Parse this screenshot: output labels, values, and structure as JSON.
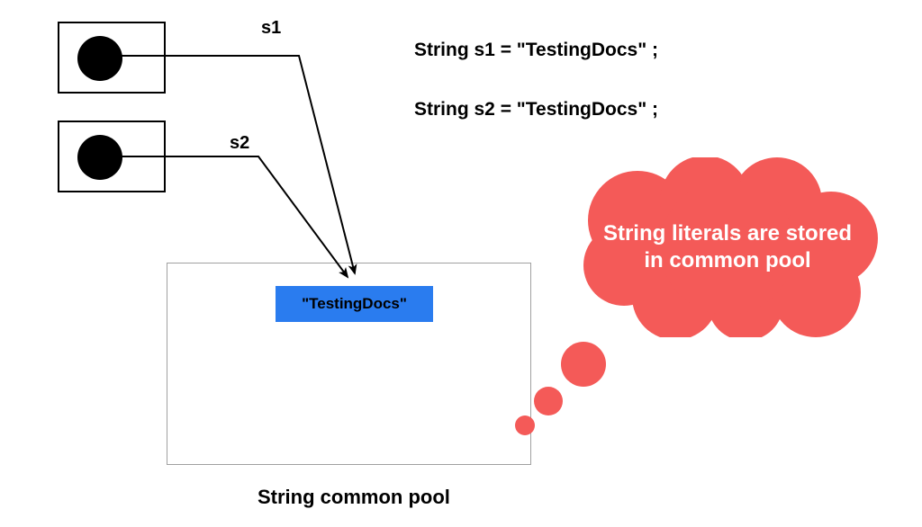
{
  "refs": {
    "s1_label": "s1",
    "s2_label": "s2"
  },
  "code": {
    "line1": "String s1 = \"TestingDocs\" ;",
    "line2": "String s2 = \"TestingDocs\" ;"
  },
  "pool": {
    "literal": "\"TestingDocs\"",
    "caption": "String common pool"
  },
  "cloud": {
    "text": "String literals are stored in common pool"
  },
  "colors": {
    "cloud": "#f45a58",
    "literal_bg": "#2a7cef"
  }
}
